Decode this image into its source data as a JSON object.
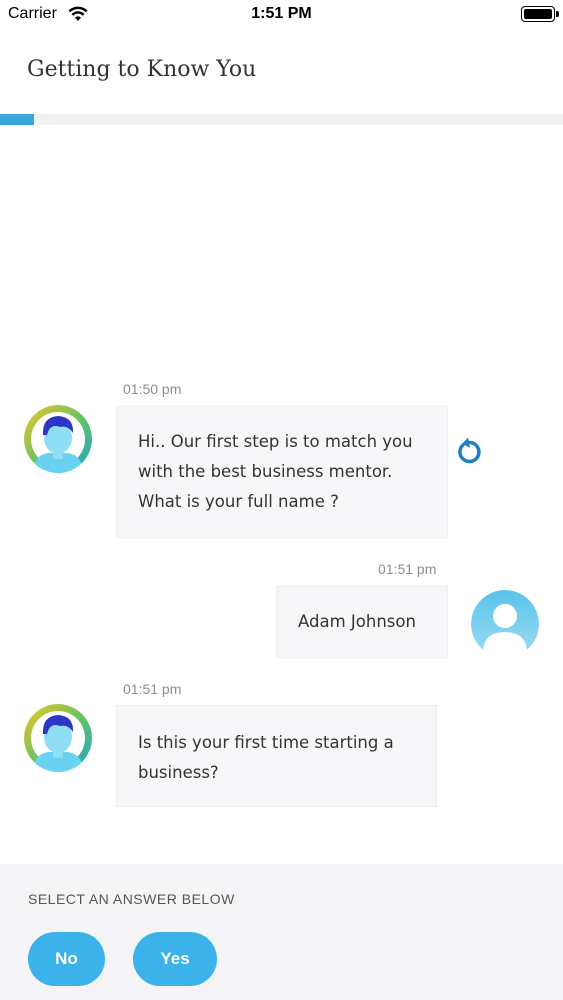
{
  "status_bar": {
    "carrier": "Carrier",
    "time": "1:51 PM"
  },
  "header": {
    "title": "Getting to Know You"
  },
  "progress": {
    "percent": 6
  },
  "messages": [
    {
      "sender": "bot",
      "time": "01:50 pm",
      "lines": [
        "Hi.. Our first step is to match you",
        "with the best business mentor.",
        "What is your full name ?"
      ]
    },
    {
      "sender": "user",
      "time": "01:51 pm",
      "lines": [
        "Adam Johnson"
      ]
    },
    {
      "sender": "bot",
      "time": "01:51 pm",
      "lines": [
        "Is this your first time starting a",
        "business?"
      ]
    }
  ],
  "answer_panel": {
    "prompt": "SELECT AN ANSWER BELOW",
    "options": [
      "No",
      "Yes"
    ]
  },
  "colors": {
    "accent": "#3aa6dc",
    "button": "#3bb2ea",
    "retry_icon": "#1f7fc4"
  },
  "icons": {
    "retry": "retry-icon",
    "wifi": "wifi-icon",
    "battery": "battery-icon"
  }
}
